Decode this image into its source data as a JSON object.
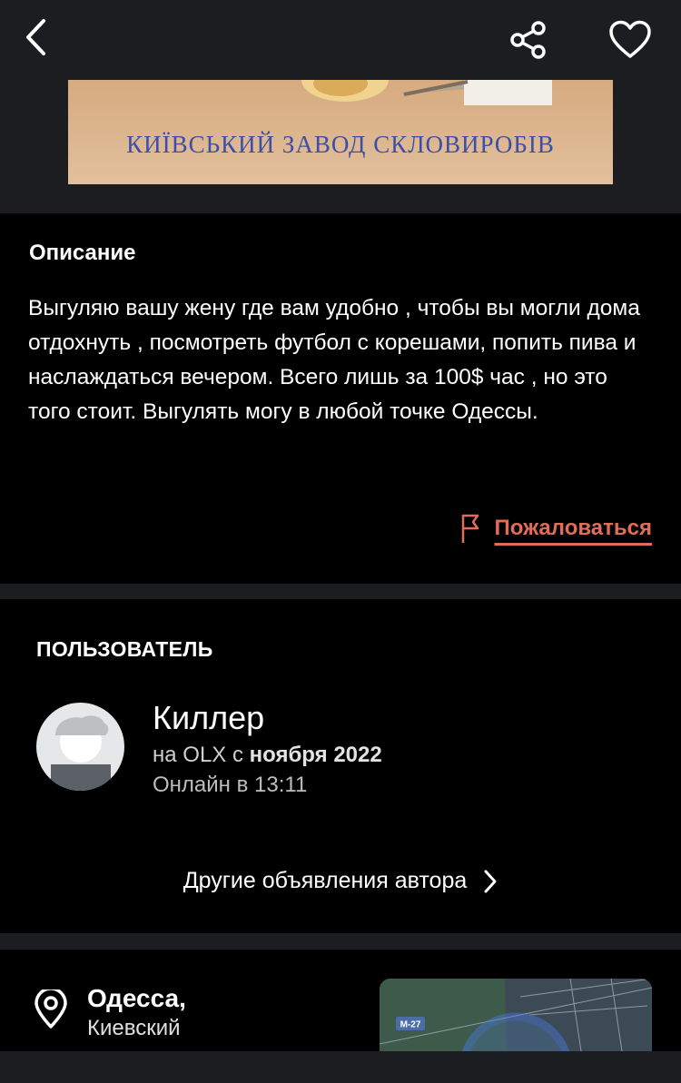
{
  "topbar": {
    "back_icon": "chevron-left-icon",
    "share_icon": "share-icon",
    "favorite_icon": "heart-icon"
  },
  "ad": {
    "text": "КИЇВСЬКИЙ ЗАВОД СКЛОВИРОБІВ"
  },
  "description": {
    "title": "Описание",
    "text": "Выгуляю вашу жену где вам удобно , чтобы вы могли дома отдохнуть , посмотреть футбол с корешами, попить пива и наслаждаться вечером. Всего лишь за 100$ час , но это того стоит. Выгулять могу в любой точке Одессы.",
    "report_label": "Пожаловаться",
    "report_icon": "flag-icon",
    "report_color": "#e06c5a"
  },
  "user": {
    "section_title": "ПОЛЬЗОВАТЕЛЬ",
    "name": "Киллер",
    "since_prefix": "на OLX с",
    "since_date": "ноября 2022",
    "online": "Онлайн в 13:11",
    "other_ads_label": "Другие объявления автора"
  },
  "location": {
    "city": "Одесса,",
    "district": "Киевский",
    "map_road_label": "M-27"
  }
}
